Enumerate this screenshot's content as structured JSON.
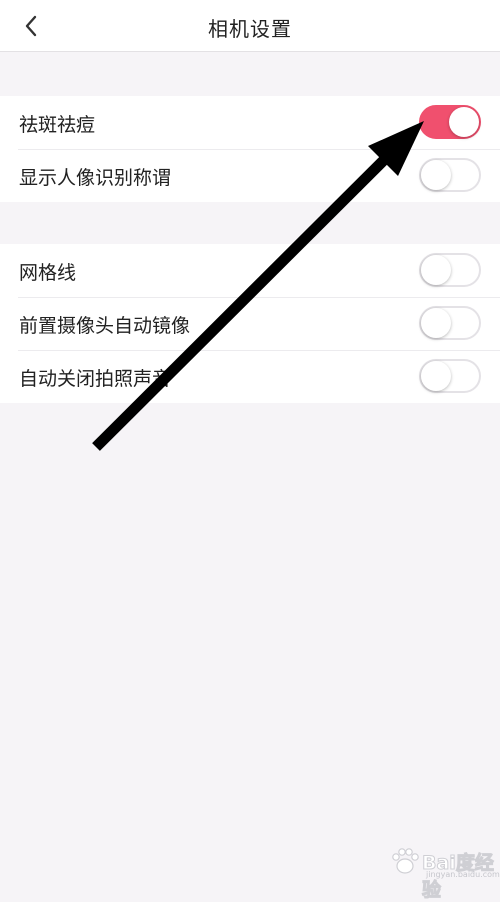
{
  "header": {
    "title": "相机设置",
    "back_icon": "chevron-left-icon"
  },
  "settings": {
    "group1": [
      {
        "label": "祛斑祛痘",
        "enabled": true
      },
      {
        "label": "显示人像识别称谓",
        "enabled": false
      }
    ],
    "group2": [
      {
        "label": "网格线",
        "enabled": false
      },
      {
        "label": "前置摄像头自动镜像",
        "enabled": false
      },
      {
        "label": "自动关闭拍照声音",
        "enabled": false
      }
    ]
  },
  "colors": {
    "toggle_on": "#f0506e",
    "background": "#f6f4f7",
    "arrow": "#000000"
  },
  "watermark": {
    "text": "Bai度经验",
    "sub": "jingyan.baidu.com"
  }
}
